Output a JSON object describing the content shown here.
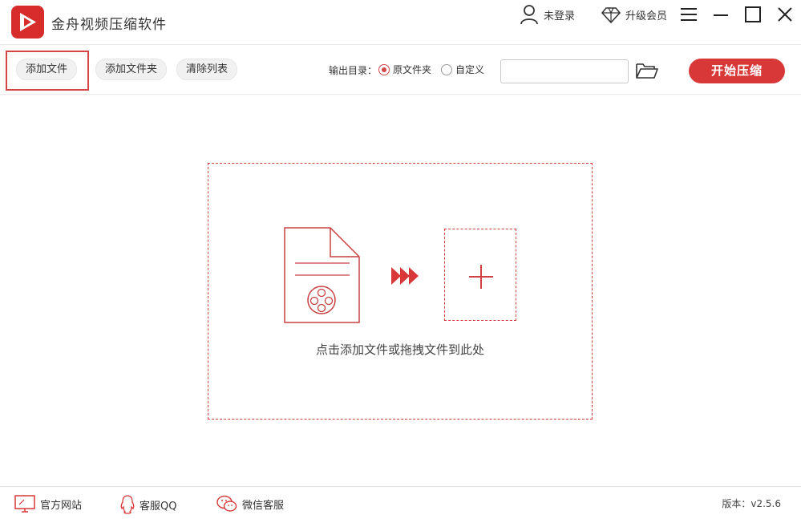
{
  "app": {
    "title": "金舟视频压缩软件"
  },
  "header": {
    "login_label": "未登录",
    "upgrade_label": "升级会员"
  },
  "toolbar": {
    "add_file": "添加文件",
    "add_folder": "添加文件夹",
    "clear_list": "清除列表",
    "output_label": "输出目录：",
    "option_original": "原文件夹",
    "option_custom": "自定义",
    "selected_option": "原文件夹",
    "path_value": "",
    "start_label": "开始压缩"
  },
  "dropzone": {
    "hint": "点击添加文件或拖拽文件到此处"
  },
  "footer": {
    "website": "官方网站",
    "qq": "客服QQ",
    "wechat": "微信客服",
    "version": "版本：v2.5.6"
  },
  "colors": {
    "accent": "#d93838",
    "border_dashed": "#d04040"
  },
  "icons": [
    "logo-icon",
    "user-icon",
    "diamond-icon",
    "menu-icon",
    "minimize-icon",
    "maximize-icon",
    "close-icon",
    "folder-open-icon",
    "video-file-icon",
    "forward-arrows-icon",
    "plus-icon",
    "monitor-icon",
    "qq-icon",
    "wechat-icon"
  ]
}
